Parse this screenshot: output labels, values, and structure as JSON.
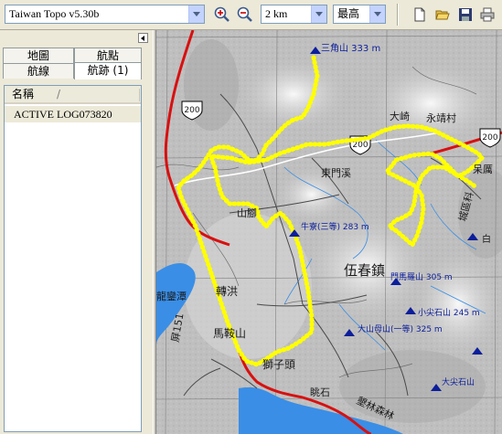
{
  "toolbar": {
    "map_product": "Taiwan Topo v5.30b",
    "scale": "2 km",
    "detail_level": "最高"
  },
  "sidebar": {
    "tabs": [
      {
        "label": "地圖"
      },
      {
        "label": "航點"
      },
      {
        "label": "航線"
      },
      {
        "label": "航跡 (1)"
      }
    ],
    "column_header": "名稱",
    "sort_indicator": "/",
    "tracks": [
      "ACTIVE LOG073820"
    ]
  },
  "map": {
    "road_shields": [
      "200",
      "200",
      "200"
    ],
    "labels": {
      "peak_sanjiaoshan": "三角山 333 m",
      "dayuan_a": "大崎",
      "yongjing": "永靖村",
      "dongmenxi": "東門溪",
      "chenggong": "呆厲",
      "laohukeng": "城區科",
      "shanjiao": "山腳",
      "niuchan": "牛寮(三等) 283 m",
      "wuchun": "伍春鎮",
      "zhuanhong": "轉洪",
      "longdan": "龍鑾潭",
      "hemanshan": "門馬羅山 305 m",
      "xiaojianshi": "小尖石山 245 m",
      "dashanmu": "大山母山(一等) 325 m",
      "ping151": "屏151",
      "majiashan": "馬鞍山",
      "shizitou": "獅子頭",
      "tiaoshi": "眺石",
      "dajianshi": "大尖石山",
      "kenting": "墾林森林",
      "bai": "白"
    }
  },
  "colors": {
    "track": "#ffff00",
    "road_red": "#d81010",
    "water": "#3a8ee6",
    "peak": "#0c1e9a"
  }
}
